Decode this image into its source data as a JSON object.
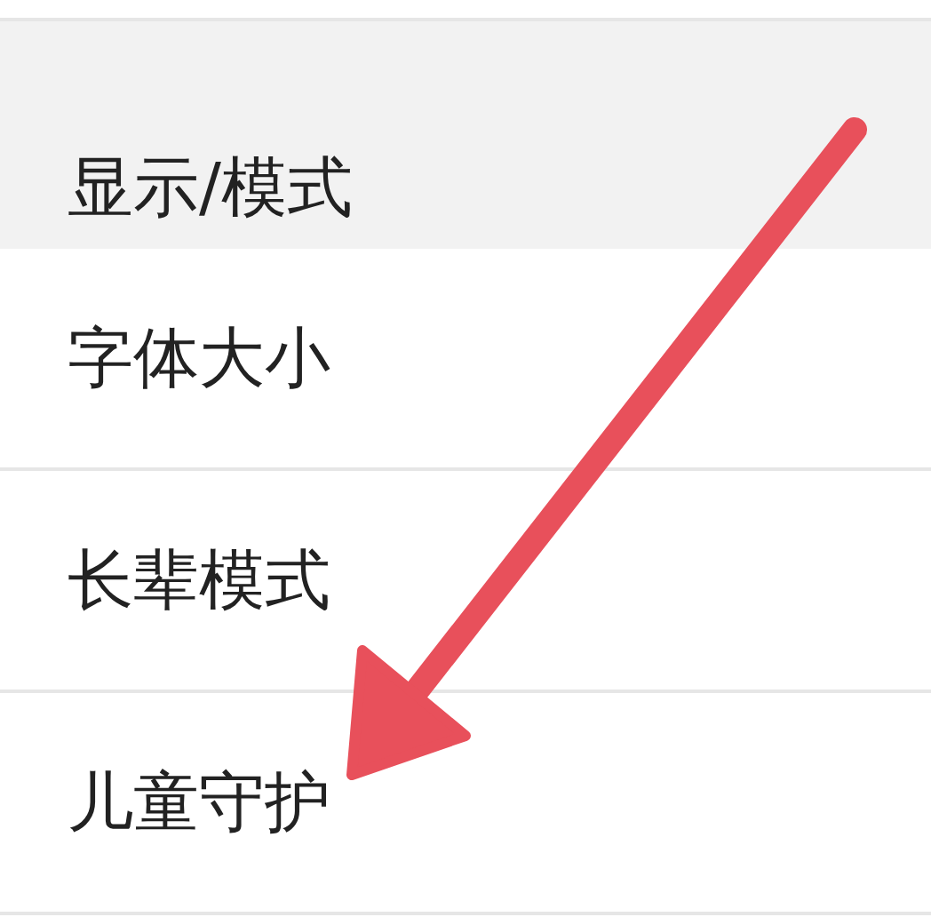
{
  "section_header": "显示/模式",
  "items": [
    {
      "label": "字体大小"
    },
    {
      "label": "长辈模式"
    },
    {
      "label": "儿童守护"
    }
  ]
}
